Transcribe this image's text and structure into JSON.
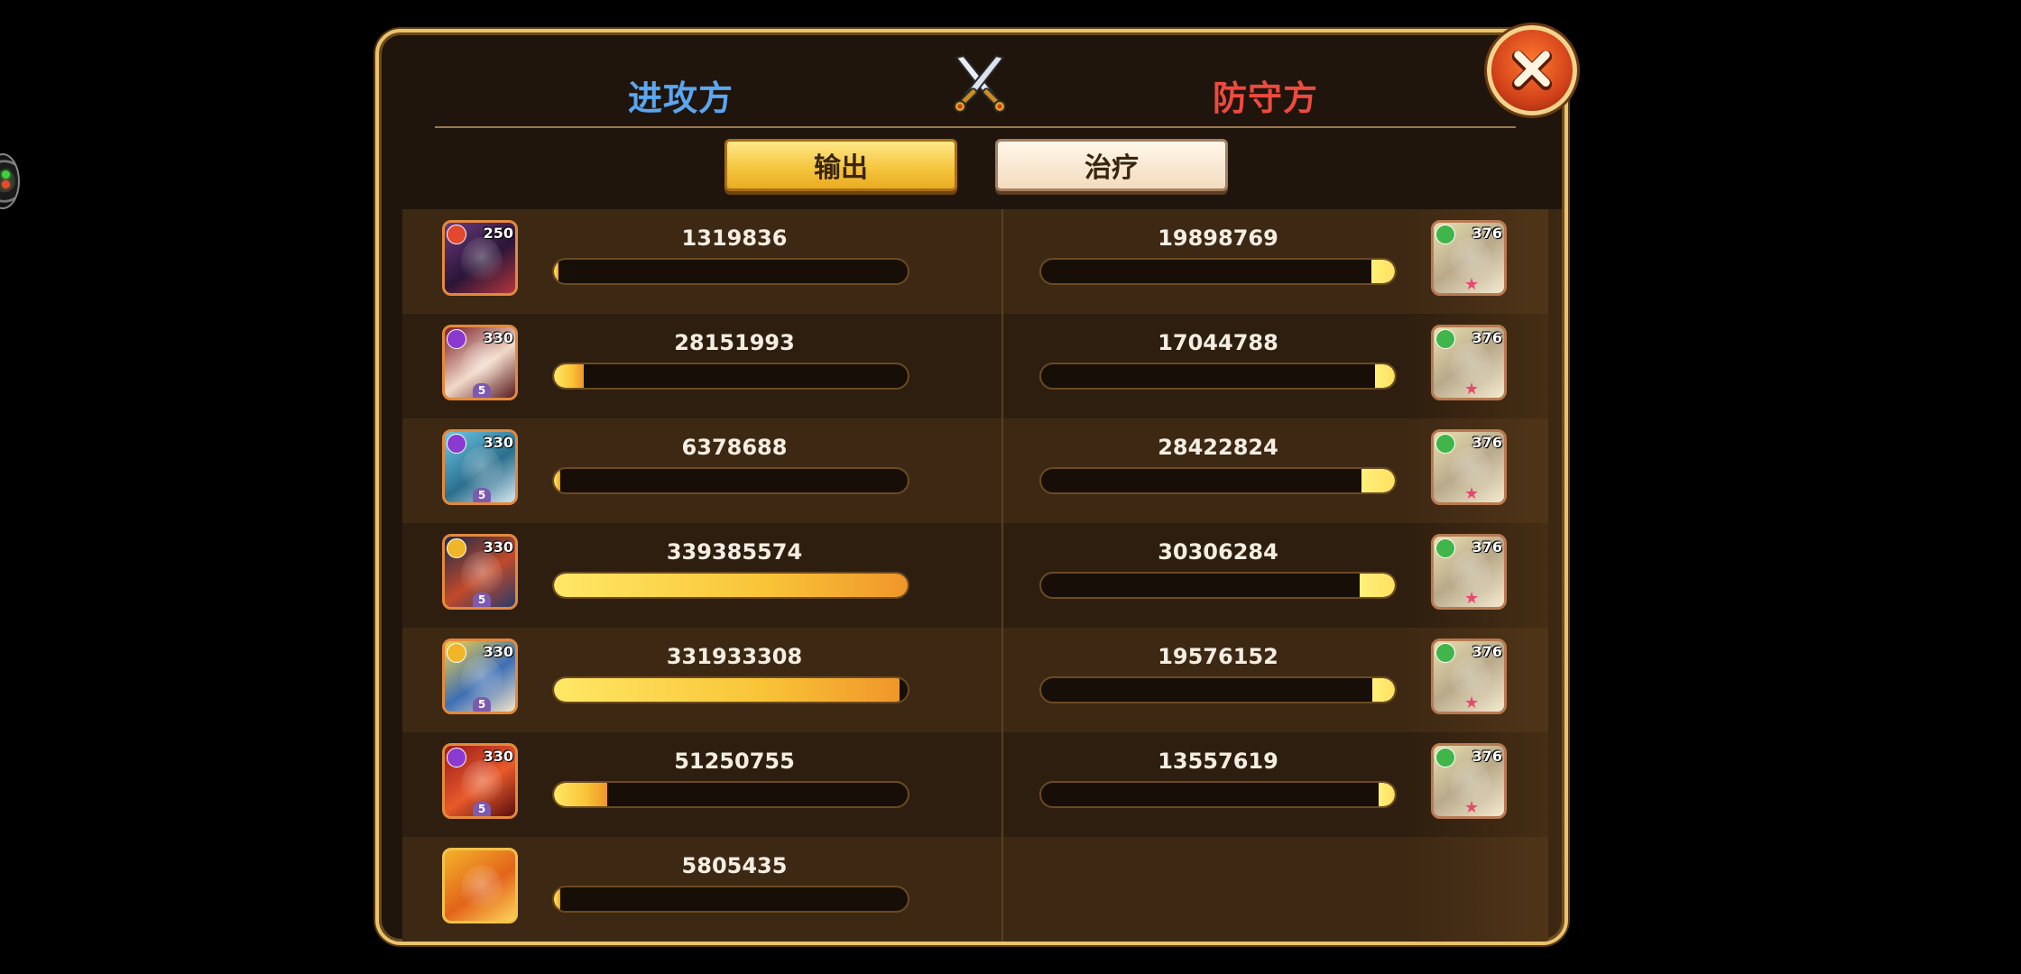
{
  "header": {
    "attack_label": "进攻方",
    "defend_label": "防守方"
  },
  "tabs": [
    {
      "label": "输出",
      "active": true
    },
    {
      "label": "治疗",
      "active": false
    }
  ],
  "colors": {
    "attack_team": "#5aa6f0",
    "defend_team": "#ef4a3e",
    "bar_fill": "#f9c437",
    "panel_border": "#e9c36d"
  },
  "attackers": [
    {
      "value": "1319836",
      "level": "250",
      "element": "fire",
      "stars": "",
      "bar_fraction": 0.004
    },
    {
      "value": "28151993",
      "level": "330",
      "element": "dark",
      "stars": "5",
      "bar_fraction": 0.083
    },
    {
      "value": "6378688",
      "level": "330",
      "element": "dark",
      "stars": "5",
      "bar_fraction": 0.019
    },
    {
      "value": "339385574",
      "level": "330",
      "element": "light",
      "stars": "5",
      "bar_fraction": 1.0
    },
    {
      "value": "331933308",
      "level": "330",
      "element": "light",
      "stars": "5",
      "bar_fraction": 0.978
    },
    {
      "value": "51250755",
      "level": "330",
      "element": "dark",
      "stars": "5",
      "bar_fraction": 0.151
    },
    {
      "value": "5805435",
      "level": "",
      "element": "",
      "stars": "",
      "bar_fraction": 0.017
    }
  ],
  "defenders": [
    {
      "value": "19898769",
      "level": "376",
      "element": "nature",
      "bar_fraction": 0.066
    },
    {
      "value": "17044788",
      "level": "376",
      "element": "nature",
      "bar_fraction": 0.056
    },
    {
      "value": "28422824",
      "level": "376",
      "element": "nature",
      "bar_fraction": 0.094
    },
    {
      "value": "30306284",
      "level": "376",
      "element": "nature",
      "bar_fraction": 0.1
    },
    {
      "value": "19576152",
      "level": "376",
      "element": "nature",
      "bar_fraction": 0.065
    },
    {
      "value": "13557619",
      "level": "376",
      "element": "nature",
      "bar_fraction": 0.045
    }
  ]
}
